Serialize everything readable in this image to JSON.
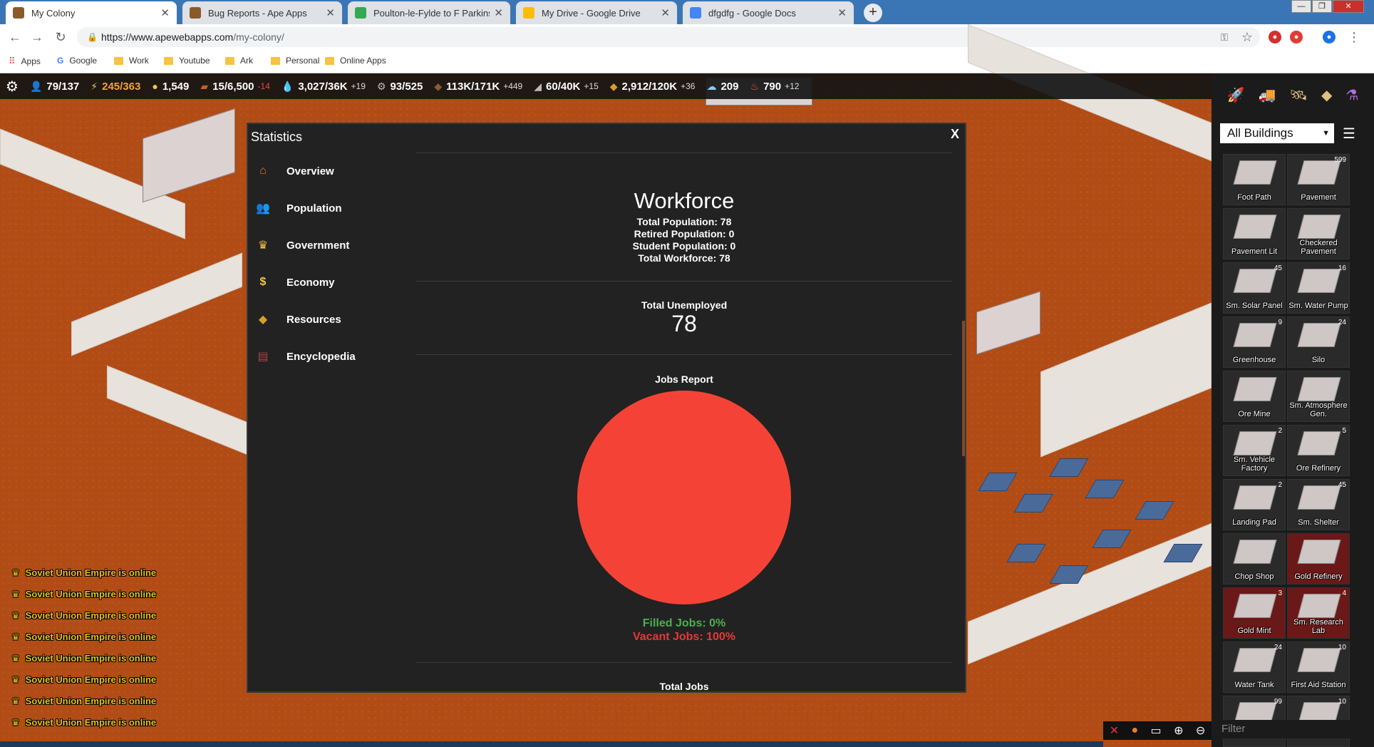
{
  "browser": {
    "tabs": [
      {
        "title": "My Colony",
        "active": true,
        "fav_color": "#8a5a2a"
      },
      {
        "title": "Bug Reports - Ape Apps",
        "active": false,
        "fav_color": "#8a5a2a"
      },
      {
        "title": "Poulton-le-Fylde to F Parkinson L",
        "active": false,
        "fav_color": "#34a853"
      },
      {
        "title": "My Drive - Google Drive",
        "active": false,
        "fav_color": "#fbbc04"
      },
      {
        "title": "dfgdfg - Google Docs",
        "active": false,
        "fav_color": "#4285f4"
      }
    ],
    "url_host": "https://www.apewebapps.com",
    "url_path": "/my-colony/",
    "bookmarks": [
      "Apps",
      "Google",
      "Work",
      "Youtube",
      "Ark",
      "Personal",
      "Online Apps"
    ]
  },
  "resources": [
    {
      "icon": "population-icon",
      "glyph": "👤",
      "color": "#f2c744",
      "value": "79/137",
      "delta": "",
      "text_color": "#ffffff"
    },
    {
      "icon": "power-icon",
      "glyph": "⚡",
      "color": "#f2c744",
      "value": "245/363",
      "delta": "",
      "text_color": "#f2a23a"
    },
    {
      "icon": "money-icon",
      "glyph": "●",
      "color": "#f2c744",
      "value": "1,549",
      "delta": "",
      "text_color": "#ffffff"
    },
    {
      "icon": "ore-icon",
      "glyph": "▰",
      "color": "#c0602a",
      "value": "15/6,500",
      "delta": "-14",
      "text_color": "#ffffff"
    },
    {
      "icon": "water-icon",
      "glyph": "💧",
      "color": "#4fa3e0",
      "value": "3,027/36K",
      "delta": "+19",
      "text_color": "#ffffff"
    },
    {
      "icon": "gear-resource-icon",
      "glyph": "⚙",
      "color": "#bbbbbb",
      "value": "93/525",
      "delta": "",
      "text_color": "#ffffff"
    },
    {
      "icon": "regolith-icon",
      "glyph": "◆",
      "color": "#8a5a3a",
      "value": "113K/171K",
      "delta": "+449",
      "text_color": "#ffffff"
    },
    {
      "icon": "aluminum-icon",
      "glyph": "◢",
      "color": "#bbbbbb",
      "value": "60/40K",
      "delta": "+15",
      "text_color": "#ffffff"
    },
    {
      "icon": "gold-icon",
      "glyph": "◆",
      "color": "#d4a02a",
      "value": "2,912/120K",
      "delta": "+36",
      "text_color": "#ffffff"
    },
    {
      "icon": "oxygen-icon",
      "glyph": "☁",
      "color": "#88ccff",
      "value": "209",
      "delta": "",
      "text_color": "#ffffff"
    },
    {
      "icon": "fire-icon",
      "glyph": "♨",
      "color": "#e8602a",
      "value": "790",
      "delta": "+12",
      "text_color": "#ffffff"
    }
  ],
  "build_panel": {
    "filter_select": "All Buildings",
    "filter_placeholder": "Filter",
    "items": [
      {
        "label": "Foot Path",
        "count": ""
      },
      {
        "label": "Pavement",
        "count": "599"
      },
      {
        "label": "Pavement Lit",
        "count": ""
      },
      {
        "label": "Checkered Pavement",
        "count": ""
      },
      {
        "label": "Sm. Solar Panel",
        "count": "45"
      },
      {
        "label": "Sm. Water Pump",
        "count": "16"
      },
      {
        "label": "Greenhouse",
        "count": "9"
      },
      {
        "label": "Silo",
        "count": "24"
      },
      {
        "label": "Ore Mine",
        "count": ""
      },
      {
        "label": "Sm. Atmosphere Gen.",
        "count": ""
      },
      {
        "label": "Sm. Vehicle Factory",
        "count": "2"
      },
      {
        "label": "Ore Refinery",
        "count": "5"
      },
      {
        "label": "Landing Pad",
        "count": "2"
      },
      {
        "label": "Sm. Shelter",
        "count": "45"
      },
      {
        "label": "Chop Shop",
        "count": ""
      },
      {
        "label": "Gold Refinery",
        "count": ""
      },
      {
        "label": "Gold Mint",
        "count": "3"
      },
      {
        "label": "Sm. Research Lab",
        "count": "4"
      },
      {
        "label": "Water Tank",
        "count": "24"
      },
      {
        "label": "First Aid Station",
        "count": "10"
      },
      {
        "label": "",
        "count": "99"
      },
      {
        "label": "",
        "count": "10"
      }
    ]
  },
  "chat": [
    "Soviet Union Empire is online",
    "Soviet Union Empire is online",
    "Soviet Union Empire is online",
    "Soviet Union Empire is online",
    "Soviet Union Empire is online",
    "Soviet Union Empire is online",
    "Soviet Union Empire is online",
    "Soviet Union Empire is online"
  ],
  "statistics": {
    "title": "Statistics",
    "close_label": "X",
    "nav": [
      {
        "label": "Overview",
        "icon": "home-icon",
        "glyph": "⌂",
        "color": "#e07a2a"
      },
      {
        "label": "Population",
        "icon": "people-icon",
        "glyph": "👥",
        "color": "#dddddd"
      },
      {
        "label": "Government",
        "icon": "crown-icon",
        "glyph": "♛",
        "color": "#f2c744"
      },
      {
        "label": "Economy",
        "icon": "coin-icon",
        "glyph": "$",
        "color": "#f2c744"
      },
      {
        "label": "Resources",
        "icon": "resources-icon",
        "glyph": "◆",
        "color": "#d4a02a"
      },
      {
        "label": "Encyclopedia",
        "icon": "book-icon",
        "glyph": "▤",
        "color": "#b04040"
      }
    ],
    "workforce_title": "Workforce",
    "workforce_lines": [
      "Total Population: 78",
      "Retired Population: 0",
      "Student Population: 0",
      "Total Workforce: 78"
    ],
    "unemployed_label": "Total Unemployed",
    "unemployed_value": "78",
    "jobs_report_title": "Jobs Report",
    "filled_jobs": "Filled Jobs: 0%",
    "vacant_jobs": "Vacant Jobs: 100%",
    "total_jobs_label": "Total Jobs"
  },
  "chart_data": {
    "type": "pie",
    "title": "Jobs Report",
    "categories": [
      "Filled Jobs",
      "Vacant Jobs"
    ],
    "values": [
      0,
      100
    ],
    "colors": [
      "#4caf50",
      "#f44336"
    ]
  }
}
